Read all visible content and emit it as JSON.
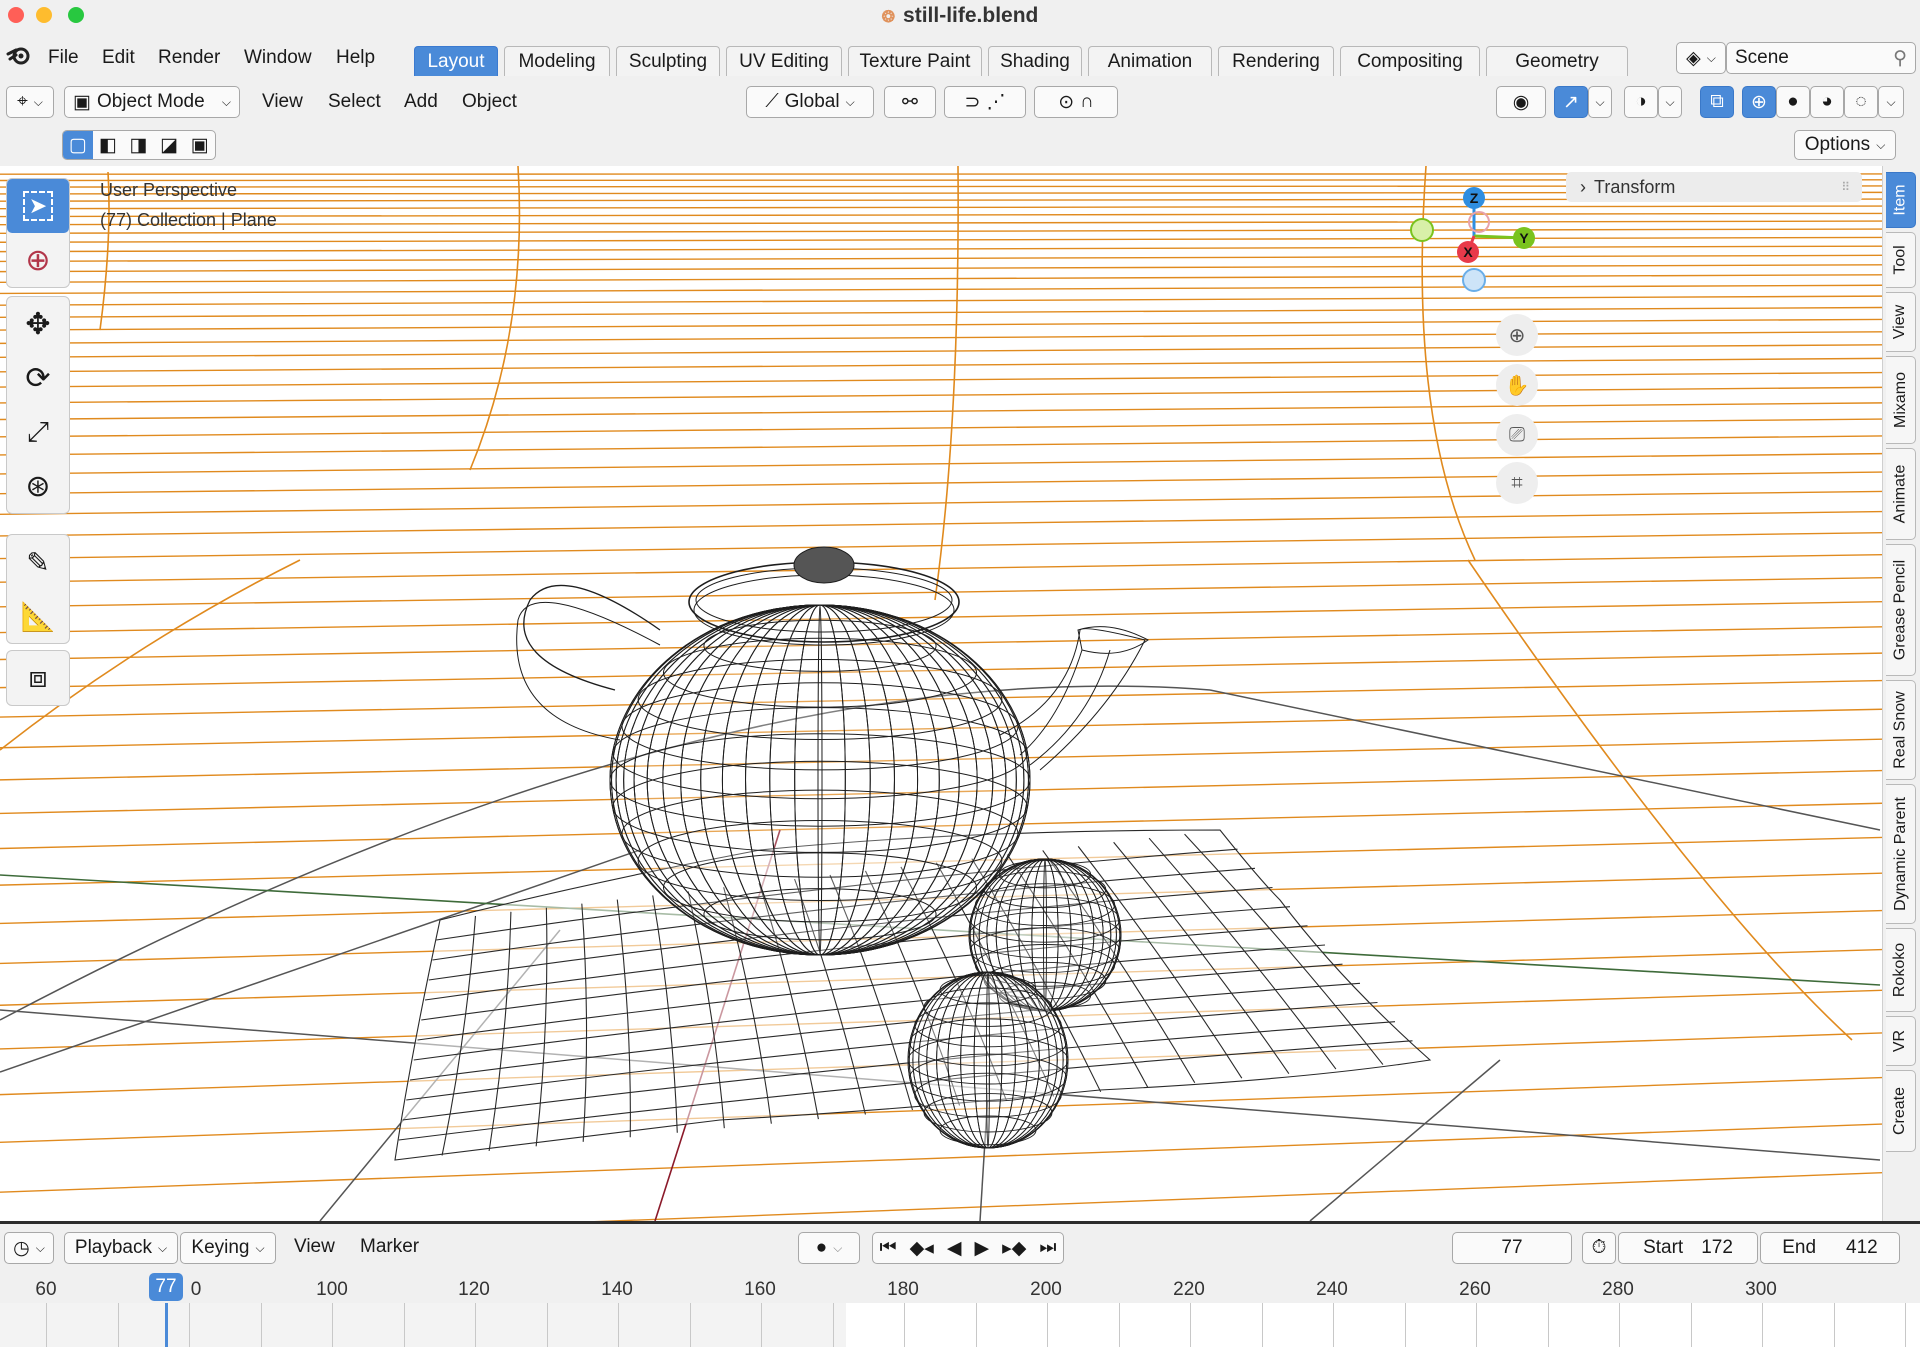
{
  "window": {
    "title": "still-life.blend",
    "file_icon": "blend-file-icon"
  },
  "menu": {
    "items": [
      "File",
      "Edit",
      "Render",
      "Window",
      "Help"
    ]
  },
  "workspaces": {
    "tabs": [
      "Layout",
      "Modeling",
      "Sculpting",
      "UV Editing",
      "Texture Paint",
      "Shading",
      "Animation",
      "Rendering",
      "Compositing",
      "Geometry Nodes"
    ],
    "active": "Layout"
  },
  "scene": {
    "name": "Scene"
  },
  "header": {
    "mode": "Object Mode",
    "menus": [
      "View",
      "Select",
      "Add",
      "Object"
    ],
    "transform_orientation": "Global",
    "options_label": "Options"
  },
  "viewport": {
    "perspective": "User Perspective",
    "collection_info": "(77) Collection | Plane",
    "gizmo_axes": {
      "z": "Z",
      "y": "Y",
      "x": "X"
    }
  },
  "sidebar": {
    "panel_title": "Transform",
    "tabs": [
      "Item",
      "Tool",
      "View",
      "Mixamo",
      "Animate",
      "Grease Pencil",
      "Real Snow",
      "Dynamic Parent",
      "Rokoko",
      "VR",
      "Create"
    ],
    "active": "Item"
  },
  "timeline": {
    "menus": [
      "Playback",
      "Keying",
      "View",
      "Marker"
    ],
    "current_frame": "77",
    "start_label": "Start",
    "start": "172",
    "end_label": "End",
    "end": "412",
    "ruler_labels": [
      "60",
      "0",
      "100",
      "120",
      "140",
      "160",
      "180",
      "200",
      "220",
      "240",
      "260",
      "280",
      "300"
    ]
  },
  "colors": {
    "accent": "#4a8ad8",
    "grid_orange": "#e08a1e",
    "wire": "#1e1e1e",
    "x_axis": "#e83a4a",
    "y_axis": "#7ac31e",
    "z_axis": "#2f8ee0"
  }
}
